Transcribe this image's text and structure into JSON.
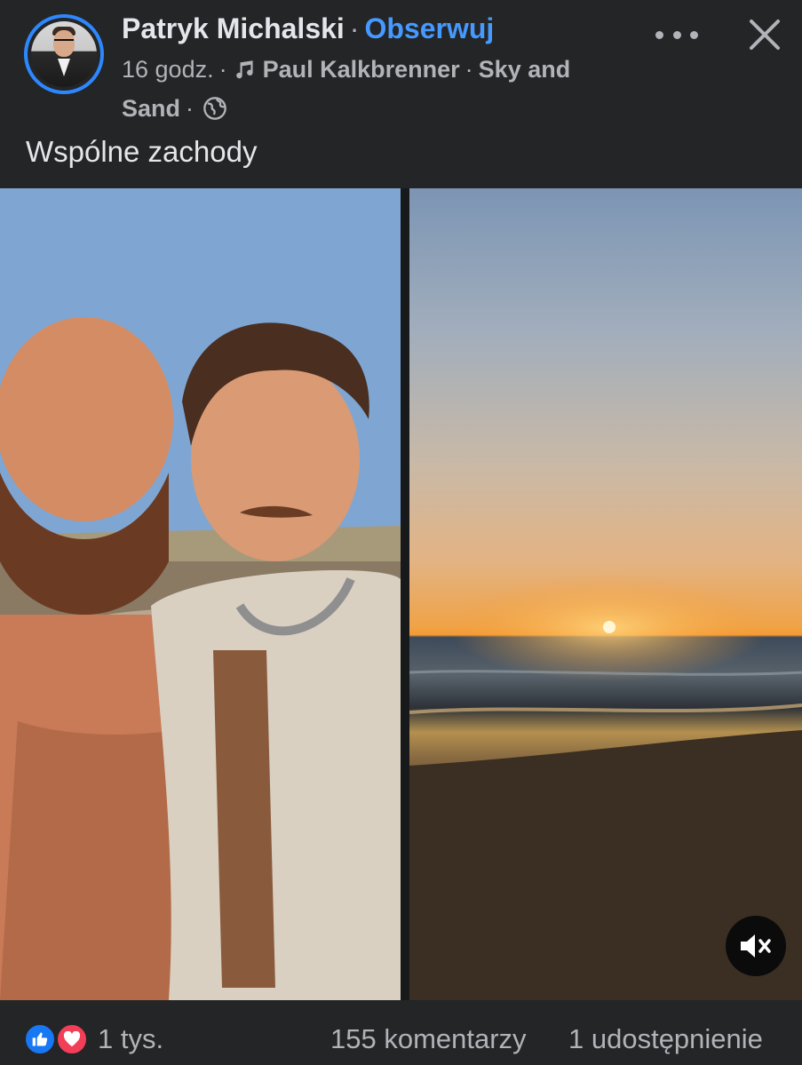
{
  "post": {
    "author": "Patryk Michalski",
    "separator": "·",
    "follow_label": "Obserwuj",
    "time": "16 godz.",
    "music_artist": "Paul Kalkbrenner",
    "music_title_part1": "Sky and",
    "music_title_part2": "Sand",
    "caption": "Wspólne zachody"
  },
  "icons": {
    "more": "more-dots-icon",
    "close": "close-x-icon",
    "music": "music-note-icon",
    "audience": "globe-icon",
    "unmute": "speaker-muted-icon",
    "like": "thumbs-up-icon",
    "love": "heart-icon"
  },
  "footer": {
    "reactions_count": "1 tys.",
    "comments": "155 komentarzy",
    "shares": "1 udostępnienie"
  },
  "colors": {
    "background": "#242526",
    "accent": "#4599ff",
    "secondary_text": "#b0b3b8",
    "like_blue": "#1877f2",
    "love_red": "#f33e58"
  }
}
